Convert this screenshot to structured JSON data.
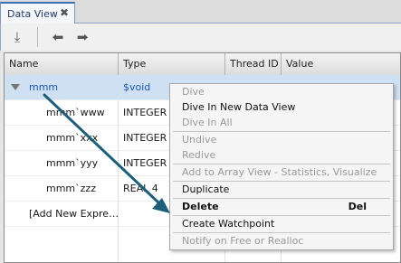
{
  "tab": {
    "title": "Data View",
    "close_glyph": "✖"
  },
  "toolbar": {
    "buttons": [
      {
        "name": "dive-icon",
        "glyph": "⤓"
      },
      {
        "name": "back-icon",
        "glyph": "⬅"
      },
      {
        "name": "forward-icon",
        "glyph": "➡"
      }
    ]
  },
  "table": {
    "columns": [
      "Name",
      "Type",
      "Thread ID",
      "Value"
    ],
    "rows": [
      {
        "name": "mmm",
        "type": "$void",
        "thread": "",
        "value": ""
      },
      {
        "name": "mmm`www",
        "type": "INTEGER",
        "thread": "",
        "value": ""
      },
      {
        "name": "mmm`xxx",
        "type": "INTEGER",
        "thread": "",
        "value": ""
      },
      {
        "name": "mmm`yyy",
        "type": "INTEGER",
        "thread": "",
        "value": ""
      },
      {
        "name": "mmm`zzz",
        "type": "REAL 4",
        "thread": "",
        "value": ""
      },
      {
        "name": "[Add New Expre…",
        "type": "",
        "thread": "",
        "value": ""
      }
    ]
  },
  "menu": {
    "dive": "Dive",
    "dive_new": "Dive In New Data View",
    "dive_all": "Dive In All",
    "undive": "Undive",
    "redive": "Redive",
    "add_array": "Add to Array View - Statistics, Visualize",
    "duplicate": "Duplicate",
    "delete": "Delete",
    "delete_shortcut": "Del",
    "watchpoint": "Create Watchpoint",
    "notify": "Notify on Free or Realloc"
  },
  "colors": {
    "arrow": "#1b5f7a",
    "selection": "#cfe0f3",
    "tab_accent": "#3a6fb4"
  }
}
